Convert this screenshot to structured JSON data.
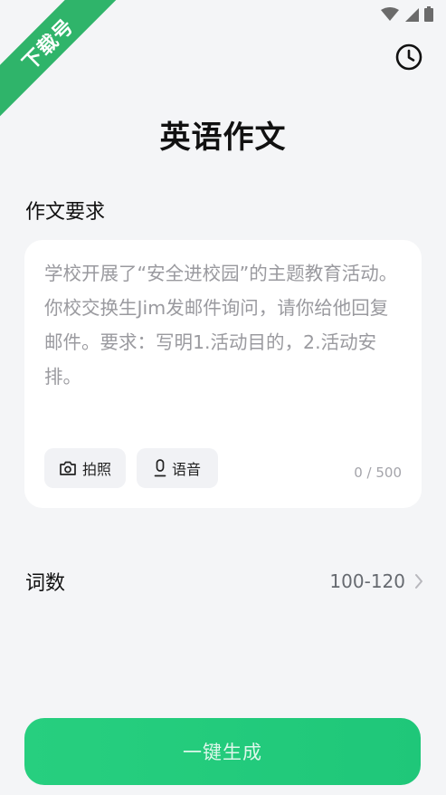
{
  "watermark": {
    "text": "下载号"
  },
  "header": {
    "title": "英语作文"
  },
  "prompt": {
    "section_label": "作文要求",
    "placeholder": "学校开展了“安全进校园”的主题教育活动。你校交换生Jim发邮件询问，请你给他回复邮件。要求：写明1.活动目的，2.活动安排。",
    "photo_label": "拍照",
    "voice_label": "语音",
    "char_count": "0 / 500"
  },
  "word_count": {
    "label": "词数",
    "value": "100-120"
  },
  "actions": {
    "generate_label": "一键生成"
  },
  "colors": {
    "accent": "#22cc7c",
    "ribbon": "#2fb46a",
    "background": "#f4f5f7"
  }
}
